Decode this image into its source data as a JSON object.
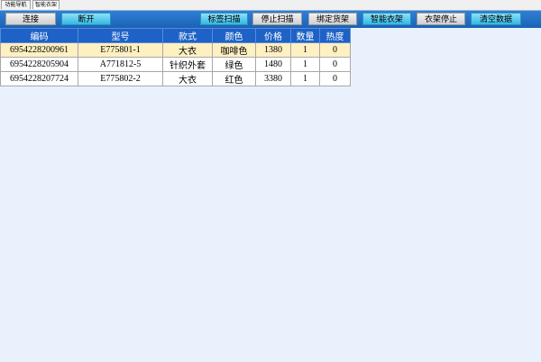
{
  "tabs": [
    {
      "label": "功能导航"
    },
    {
      "label": "智能衣架"
    }
  ],
  "toolbar": {
    "connect": "连接",
    "disconnect": "断开",
    "tag_scan": "标签扫描",
    "stop_scan": "停止扫描",
    "bind_shelf": "绑定货架",
    "smart_hanger": "智能衣架",
    "hanger_stop": "衣架停止",
    "clear_data": "清空数据"
  },
  "table": {
    "headers": [
      "编码",
      "型号",
      "款式",
      "颜色",
      "价格",
      "数量",
      "热度"
    ],
    "rows": [
      [
        "6954228200961",
        "E775801-1",
        "大衣",
        "咖啡色",
        "1380",
        "1",
        "0"
      ],
      [
        "6954228205904",
        "A771812-5",
        "针织外套",
        "绿色",
        "1480",
        "1",
        "0"
      ],
      [
        "6954228207724",
        "E775802-2",
        "大衣",
        "红色",
        "3380",
        "1",
        "0"
      ]
    ],
    "selected_row": 0
  }
}
